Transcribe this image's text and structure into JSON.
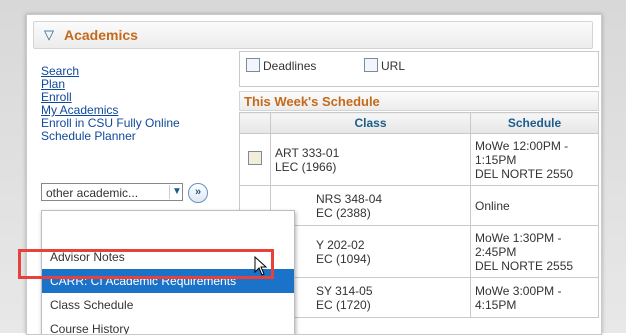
{
  "section": {
    "title": "Academics"
  },
  "links": [
    "Search",
    "Plan",
    "Enroll",
    "My Academics",
    "Enroll in CSU Fully Online",
    "Schedule Planner"
  ],
  "select": {
    "value": "other academic..."
  },
  "dropdown": {
    "options": [
      "Advisor Notes",
      "CARR: CI Academic Requirements",
      "Class Schedule",
      "Course History"
    ],
    "selected": "CARR: CI Academic Requirements"
  },
  "toolbar": {
    "deadlines": "Deadlines",
    "url": "URL"
  },
  "schedule": {
    "title": "This Week's Schedule",
    "headers": [
      "Class",
      "Schedule"
    ],
    "rows": [
      {
        "class_line1": "ART 333-01",
        "class_line2": "LEC (1966)",
        "schedule_lines": [
          "MoWe 12:00PM -",
          "1:15PM",
          "DEL NORTE 2550"
        ]
      },
      {
        "class_line1": "NRS 348-04",
        "class_line2": "EC (2388)",
        "schedule_lines": [
          "Online"
        ]
      },
      {
        "class_line1": "Y 202-02",
        "class_line2": "EC (1094)",
        "schedule_lines": [
          "MoWe 1:30PM -",
          "2:45PM",
          "DEL NORTE 2555"
        ]
      },
      {
        "class_line1": "SY 314-05",
        "class_line2": "EC (1720)",
        "schedule_lines": [
          "MoWe 3:00PM -",
          "4:15PM"
        ]
      }
    ]
  },
  "colors": {
    "accent_orange": "#c46a1b",
    "link_blue": "#10489a",
    "highlight_red": "#e8413c",
    "selection_blue": "#1a73c9"
  }
}
